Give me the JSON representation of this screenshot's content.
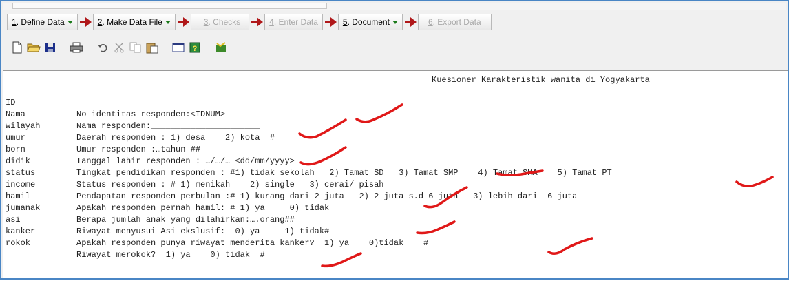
{
  "wizard": {
    "steps": [
      {
        "num": "1",
        "label": ". Define Data",
        "has_dropdown": true,
        "enabled": true
      },
      {
        "num": "2",
        "label": ". Make Data File",
        "has_dropdown": true,
        "enabled": true
      },
      {
        "num": "3",
        "label": ". Checks",
        "has_dropdown": false,
        "enabled": false
      },
      {
        "num": "4",
        "label": ". Enter Data",
        "has_dropdown": false,
        "enabled": false
      },
      {
        "num": "5",
        "label": ". Document",
        "has_dropdown": true,
        "enabled": true
      },
      {
        "num": "6",
        "label": ". Export Data",
        "has_dropdown": false,
        "enabled": false
      }
    ]
  },
  "toolbar": {
    "icons": [
      "new-file-icon",
      "open-folder-icon",
      "save-icon",
      "print-icon",
      "undo-icon",
      "cut-icon",
      "copy-icon",
      "paste-icon",
      "window-icon",
      "help-icon",
      "data-icon"
    ]
  },
  "editor": {
    "title": "Kuesioner Karakteristik wanita di Yogyakarta",
    "rows": [
      {
        "var": "ID",
        "text": "No identitas responden:<IDNUM>"
      },
      {
        "var": "Nama",
        "text": "Nama responden:______________________"
      },
      {
        "var": "wilayah",
        "text": "Daerah responden : 1) desa    2) kota  #"
      },
      {
        "var": "umur",
        "text": "Umur responden :…tahun ##"
      },
      {
        "var": "born",
        "text": "Tanggal lahir responden : …/…/… <dd/mm/yyyy>"
      },
      {
        "var": "didik",
        "text": "Tingkat pendidikan responden : #1) tidak sekolah   2) Tamat SD   3) Tamat SMP    4) Tamat SMA    5) Tamat PT"
      },
      {
        "var": "status",
        "text": "Status responden : # 1) menikah    2) single   3) cerai/ pisah"
      },
      {
        "var": "income",
        "text": "Pendapatan responden perbulan :# 1) kurang dari 2 juta   2) 2 juta s.d 6 juta   3) lebih dari  6 juta"
      },
      {
        "var": "hamil",
        "text": "Apakah responden pernah hamil: # 1) ya     0) tidak"
      },
      {
        "var": "jumanak",
        "text": "Berapa jumlah anak yang dilahirkan:….orang##"
      },
      {
        "var": "asi",
        "text": "Riwayat menyusui Asi ekslusif:  0) ya     1) tidak#"
      },
      {
        "var": "kanker",
        "text": "Apakah responden punya riwayat menderita kanker?  1) ya    0)tidak    #"
      },
      {
        "var": "rokok",
        "text": "Riwayat merokok?  1) ya    0) tidak  #"
      }
    ]
  }
}
